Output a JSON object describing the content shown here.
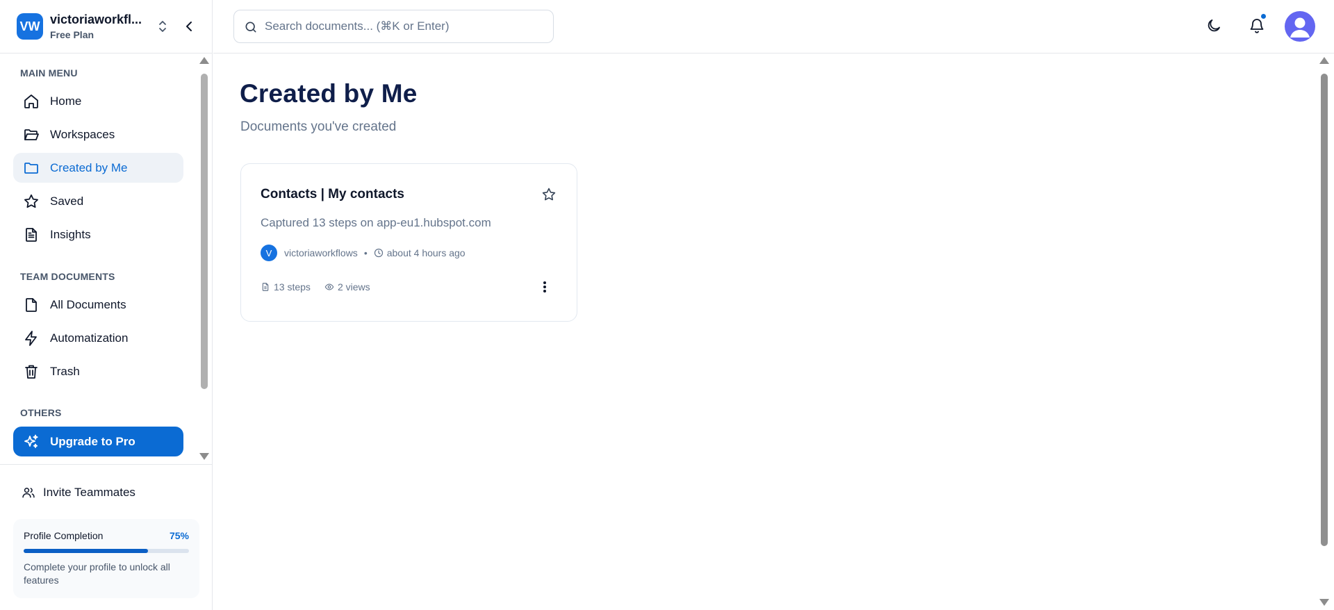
{
  "colors": {
    "accent": "#0b6bd3",
    "active_bg": "#eef2f7",
    "title": "#0f1e4a",
    "muted": "#64748b",
    "avatar_bg": "#6366f1"
  },
  "workspace": {
    "initials": "VW",
    "name": "victoriaworkfl...",
    "plan": "Free Plan"
  },
  "sidebar": {
    "main_menu_label": "MAIN MENU",
    "main_items": [
      {
        "label": "Home",
        "icon": "home-icon"
      },
      {
        "label": "Workspaces",
        "icon": "folder-open-icon"
      },
      {
        "label": "Created by Me",
        "icon": "folder-icon",
        "active": true
      },
      {
        "label": "Saved",
        "icon": "star-icon"
      },
      {
        "label": "Insights",
        "icon": "file-text-icon"
      }
    ],
    "team_label": "TEAM DOCUMENTS",
    "team_items": [
      {
        "label": "All Documents",
        "icon": "file-icon"
      },
      {
        "label": "Automatization",
        "icon": "zap-icon"
      },
      {
        "label": "Trash",
        "icon": "trash-icon"
      }
    ],
    "others_label": "OTHERS",
    "upgrade_label": "Upgrade to Pro",
    "invite_label": "Invite Teammates",
    "profile": {
      "title": "Profile Completion",
      "percent_text": "75%",
      "percent": 75,
      "description": "Complete your profile to unlock all features"
    }
  },
  "topbar": {
    "search_placeholder": "Search documents... (⌘K or Enter)"
  },
  "main": {
    "title": "Created by Me",
    "subtitle": "Documents you've created",
    "documents": [
      {
        "title": "Contacts | My contacts",
        "description": "Captured 13 steps on app-eu1.hubspot.com",
        "author_initial": "V",
        "author": "victoriaworkflows",
        "time": "about 4 hours ago",
        "steps": "13 steps",
        "views": "2 views"
      }
    ]
  }
}
